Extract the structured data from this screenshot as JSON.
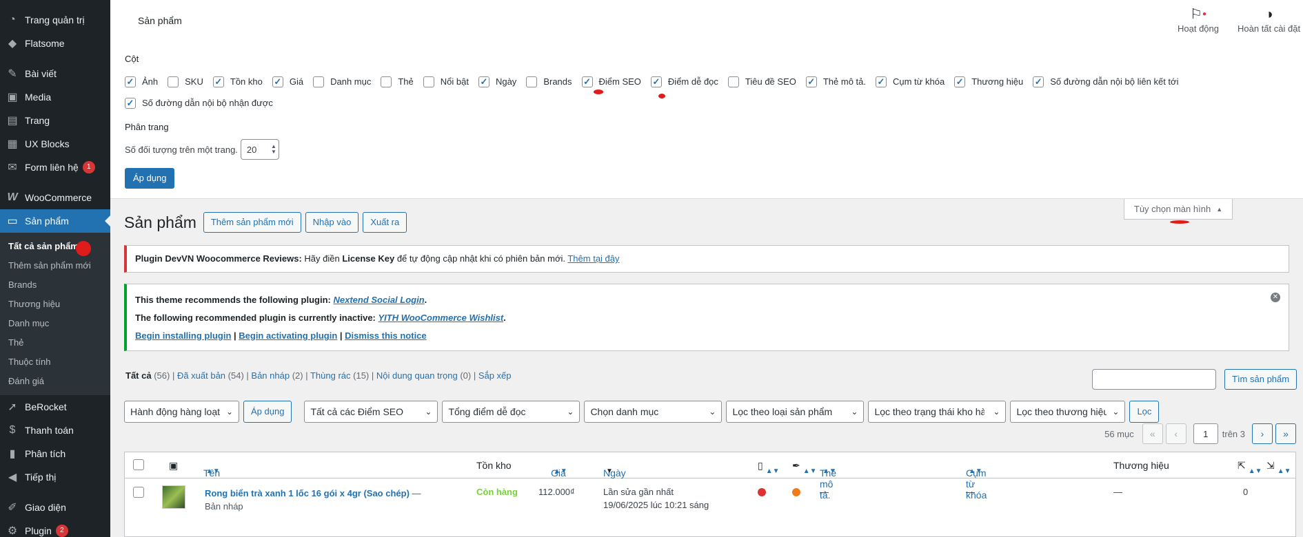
{
  "menu": {
    "items": [
      {
        "label": "Trang quản trị",
        "icon": "dashboard-icon"
      },
      {
        "label": "Flatsome",
        "icon": "flatsome-icon"
      },
      {
        "label": "Bài viết",
        "icon": "pin-icon"
      },
      {
        "label": "Media",
        "icon": "media-icon"
      },
      {
        "label": "Trang",
        "icon": "page-icon"
      },
      {
        "label": "UX Blocks",
        "icon": "blocks-icon"
      },
      {
        "label": "Form liên hệ",
        "icon": "mail-icon",
        "badge": "1"
      },
      {
        "label": "WooCommerce",
        "icon": "woo-icon"
      },
      {
        "label": "Sản phẩm",
        "icon": "archive-icon"
      }
    ],
    "sub": [
      "Tất cả sản phẩm",
      "Thêm sản phẩm mới",
      "Brands",
      "Thương hiệu",
      "Danh mục",
      "Thẻ",
      "Thuộc tính",
      "Đánh giá"
    ],
    "after": [
      {
        "label": "BeRocket",
        "icon": "rocket-icon"
      },
      {
        "label": "Thanh toán",
        "icon": "dollar-icon"
      },
      {
        "label": "Phân tích",
        "icon": "chart-icon"
      },
      {
        "label": "Tiếp thị",
        "icon": "megaphone-icon"
      },
      {
        "label": "Giao diện",
        "icon": "brush-icon"
      },
      {
        "label": "Plugin",
        "icon": "plugin-icon",
        "badge": "2"
      }
    ]
  },
  "topbar": {
    "title": "Sản phẩm",
    "activity": "Hoạt động",
    "setup": "Hoàn tất cài đặt"
  },
  "screen_options": {
    "columns_heading": "Cột",
    "columns": [
      {
        "label": "Ảnh",
        "checked": true
      },
      {
        "label": "SKU",
        "checked": false
      },
      {
        "label": "Tồn kho",
        "checked": true
      },
      {
        "label": "Giá",
        "checked": true
      },
      {
        "label": "Danh mục",
        "checked": false
      },
      {
        "label": "Thẻ",
        "checked": false
      },
      {
        "label": "Nổi bật",
        "checked": false
      },
      {
        "label": "Ngày",
        "checked": true
      },
      {
        "label": "Brands",
        "checked": false
      },
      {
        "label": "Điểm SEO",
        "checked": true
      },
      {
        "label": "Điểm dễ đọc",
        "checked": true
      },
      {
        "label": "Tiêu đề SEO",
        "checked": false
      },
      {
        "label": "Thẻ mô tả.",
        "checked": true
      },
      {
        "label": "Cụm từ khóa",
        "checked": true
      },
      {
        "label": "Thương hiệu",
        "checked": true
      },
      {
        "label": "Số đường dẫn nội bộ liên kết tới",
        "checked": true
      },
      {
        "label": "Số đường dẫn nội bộ nhận được",
        "checked": true
      }
    ],
    "pagination_heading": "Phân trang",
    "per_page_label": "Số đối tượng trên một trang.",
    "per_page_value": "20",
    "apply": "Áp dụng",
    "tab_label": "Tùy chọn màn hình"
  },
  "page": {
    "heading": "Sản phẩm",
    "add_new": "Thêm sản phẩm mới",
    "import": "Nhập vào",
    "export": "Xuất ra"
  },
  "notice1": {
    "bold": "Plugin DevVN Woocommerce Reviews:",
    "text1": " Hãy điền ",
    "bold2": "License Key",
    "text2": " để tự động cập nhật khi có phiên bản mới. ",
    "link": "Thêm tại đây"
  },
  "notice2": {
    "l1a": "This theme recommends the following plugin: ",
    "l1link": "Nextend Social Login",
    "l1b": ".",
    "l2a": "The following recommended plugin is currently inactive: ",
    "l2link": "YITH WooCommerce Wishlist",
    "l2b": ".",
    "a1": "Begin installing plugin",
    "a2": "Begin activating plugin",
    "a3": "Dismiss this notice"
  },
  "views": {
    "all": "Tất cả",
    "all_count": "(56)",
    "published": "Đã xuất bản",
    "published_count": "(54)",
    "draft": "Bản nháp",
    "draft_count": "(2)",
    "trash": "Thùng rác",
    "trash_count": "(15)",
    "important": "Nội dung quan trọng",
    "important_count": "(0)",
    "sort": "Sắp xếp"
  },
  "search": {
    "button": "Tìm sản phẩm"
  },
  "filters": {
    "bulk": "Hành động hàng loạt",
    "apply": "Áp dụng",
    "seo": "Tất cả các Điểm SEO",
    "read": "Tổng điểm dễ đọc",
    "cat": "Chọn danh mục",
    "type": "Lọc theo loại sản phẩm",
    "stock": "Lọc theo trạng thái kho hàng",
    "brand": "Lọc theo thương hiệu",
    "filter": "Lọc"
  },
  "pagination": {
    "count": "56 mục",
    "first": "«",
    "prev": "‹",
    "current": "1",
    "of": "trên 3",
    "next": "›",
    "last": "»"
  },
  "table": {
    "headers": {
      "name": "Tên",
      "stock": "Tồn kho",
      "price": "Giá",
      "date": "Ngày",
      "desc": "Thẻ mô tả.",
      "keyphrase": "Cụm từ khóa",
      "brand": "Thương hiệu"
    },
    "rows": [
      {
        "name": "Rong biển trà xanh 1 lốc 16 gói x 4gr (Sao chép)",
        "state": "— Bản nháp",
        "stock": "Còn hàng",
        "price": "112.000₫",
        "date_label": "Lần sửa gần nhất",
        "date": "19/06/2025 lúc 10:21 sáng",
        "desc": "—",
        "keyphrase": "—",
        "brand": "—",
        "links": "0"
      }
    ]
  }
}
